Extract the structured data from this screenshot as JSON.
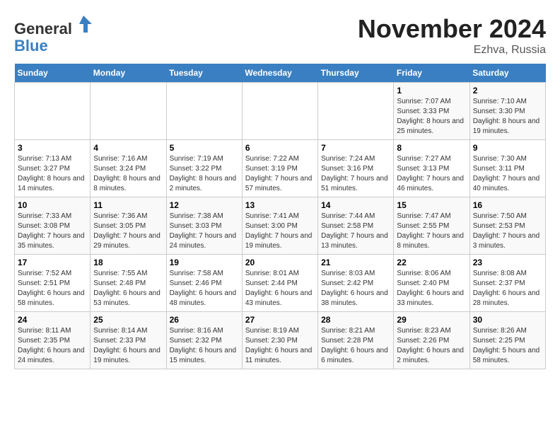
{
  "header": {
    "logo_general": "General",
    "logo_blue": "Blue",
    "month_title": "November 2024",
    "subtitle": "Ezhva, Russia"
  },
  "days_of_week": [
    "Sunday",
    "Monday",
    "Tuesday",
    "Wednesday",
    "Thursday",
    "Friday",
    "Saturday"
  ],
  "weeks": [
    [
      {
        "day": "",
        "info": ""
      },
      {
        "day": "",
        "info": ""
      },
      {
        "day": "",
        "info": ""
      },
      {
        "day": "",
        "info": ""
      },
      {
        "day": "",
        "info": ""
      },
      {
        "day": "1",
        "info": "Sunrise: 7:07 AM\nSunset: 3:33 PM\nDaylight: 8 hours and 25 minutes."
      },
      {
        "day": "2",
        "info": "Sunrise: 7:10 AM\nSunset: 3:30 PM\nDaylight: 8 hours and 19 minutes."
      }
    ],
    [
      {
        "day": "3",
        "info": "Sunrise: 7:13 AM\nSunset: 3:27 PM\nDaylight: 8 hours and 14 minutes."
      },
      {
        "day": "4",
        "info": "Sunrise: 7:16 AM\nSunset: 3:24 PM\nDaylight: 8 hours and 8 minutes."
      },
      {
        "day": "5",
        "info": "Sunrise: 7:19 AM\nSunset: 3:22 PM\nDaylight: 8 hours and 2 minutes."
      },
      {
        "day": "6",
        "info": "Sunrise: 7:22 AM\nSunset: 3:19 PM\nDaylight: 7 hours and 57 minutes."
      },
      {
        "day": "7",
        "info": "Sunrise: 7:24 AM\nSunset: 3:16 PM\nDaylight: 7 hours and 51 minutes."
      },
      {
        "day": "8",
        "info": "Sunrise: 7:27 AM\nSunset: 3:13 PM\nDaylight: 7 hours and 46 minutes."
      },
      {
        "day": "9",
        "info": "Sunrise: 7:30 AM\nSunset: 3:11 PM\nDaylight: 7 hours and 40 minutes."
      }
    ],
    [
      {
        "day": "10",
        "info": "Sunrise: 7:33 AM\nSunset: 3:08 PM\nDaylight: 7 hours and 35 minutes."
      },
      {
        "day": "11",
        "info": "Sunrise: 7:36 AM\nSunset: 3:05 PM\nDaylight: 7 hours and 29 minutes."
      },
      {
        "day": "12",
        "info": "Sunrise: 7:38 AM\nSunset: 3:03 PM\nDaylight: 7 hours and 24 minutes."
      },
      {
        "day": "13",
        "info": "Sunrise: 7:41 AM\nSunset: 3:00 PM\nDaylight: 7 hours and 19 minutes."
      },
      {
        "day": "14",
        "info": "Sunrise: 7:44 AM\nSunset: 2:58 PM\nDaylight: 7 hours and 13 minutes."
      },
      {
        "day": "15",
        "info": "Sunrise: 7:47 AM\nSunset: 2:55 PM\nDaylight: 7 hours and 8 minutes."
      },
      {
        "day": "16",
        "info": "Sunrise: 7:50 AM\nSunset: 2:53 PM\nDaylight: 7 hours and 3 minutes."
      }
    ],
    [
      {
        "day": "17",
        "info": "Sunrise: 7:52 AM\nSunset: 2:51 PM\nDaylight: 6 hours and 58 minutes."
      },
      {
        "day": "18",
        "info": "Sunrise: 7:55 AM\nSunset: 2:48 PM\nDaylight: 6 hours and 53 minutes."
      },
      {
        "day": "19",
        "info": "Sunrise: 7:58 AM\nSunset: 2:46 PM\nDaylight: 6 hours and 48 minutes."
      },
      {
        "day": "20",
        "info": "Sunrise: 8:01 AM\nSunset: 2:44 PM\nDaylight: 6 hours and 43 minutes."
      },
      {
        "day": "21",
        "info": "Sunrise: 8:03 AM\nSunset: 2:42 PM\nDaylight: 6 hours and 38 minutes."
      },
      {
        "day": "22",
        "info": "Sunrise: 8:06 AM\nSunset: 2:40 PM\nDaylight: 6 hours and 33 minutes."
      },
      {
        "day": "23",
        "info": "Sunrise: 8:08 AM\nSunset: 2:37 PM\nDaylight: 6 hours and 28 minutes."
      }
    ],
    [
      {
        "day": "24",
        "info": "Sunrise: 8:11 AM\nSunset: 2:35 PM\nDaylight: 6 hours and 24 minutes."
      },
      {
        "day": "25",
        "info": "Sunrise: 8:14 AM\nSunset: 2:33 PM\nDaylight: 6 hours and 19 minutes."
      },
      {
        "day": "26",
        "info": "Sunrise: 8:16 AM\nSunset: 2:32 PM\nDaylight: 6 hours and 15 minutes."
      },
      {
        "day": "27",
        "info": "Sunrise: 8:19 AM\nSunset: 2:30 PM\nDaylight: 6 hours and 11 minutes."
      },
      {
        "day": "28",
        "info": "Sunrise: 8:21 AM\nSunset: 2:28 PM\nDaylight: 6 hours and 6 minutes."
      },
      {
        "day": "29",
        "info": "Sunrise: 8:23 AM\nSunset: 2:26 PM\nDaylight: 6 hours and 2 minutes."
      },
      {
        "day": "30",
        "info": "Sunrise: 8:26 AM\nSunset: 2:25 PM\nDaylight: 5 hours and 58 minutes."
      }
    ]
  ]
}
